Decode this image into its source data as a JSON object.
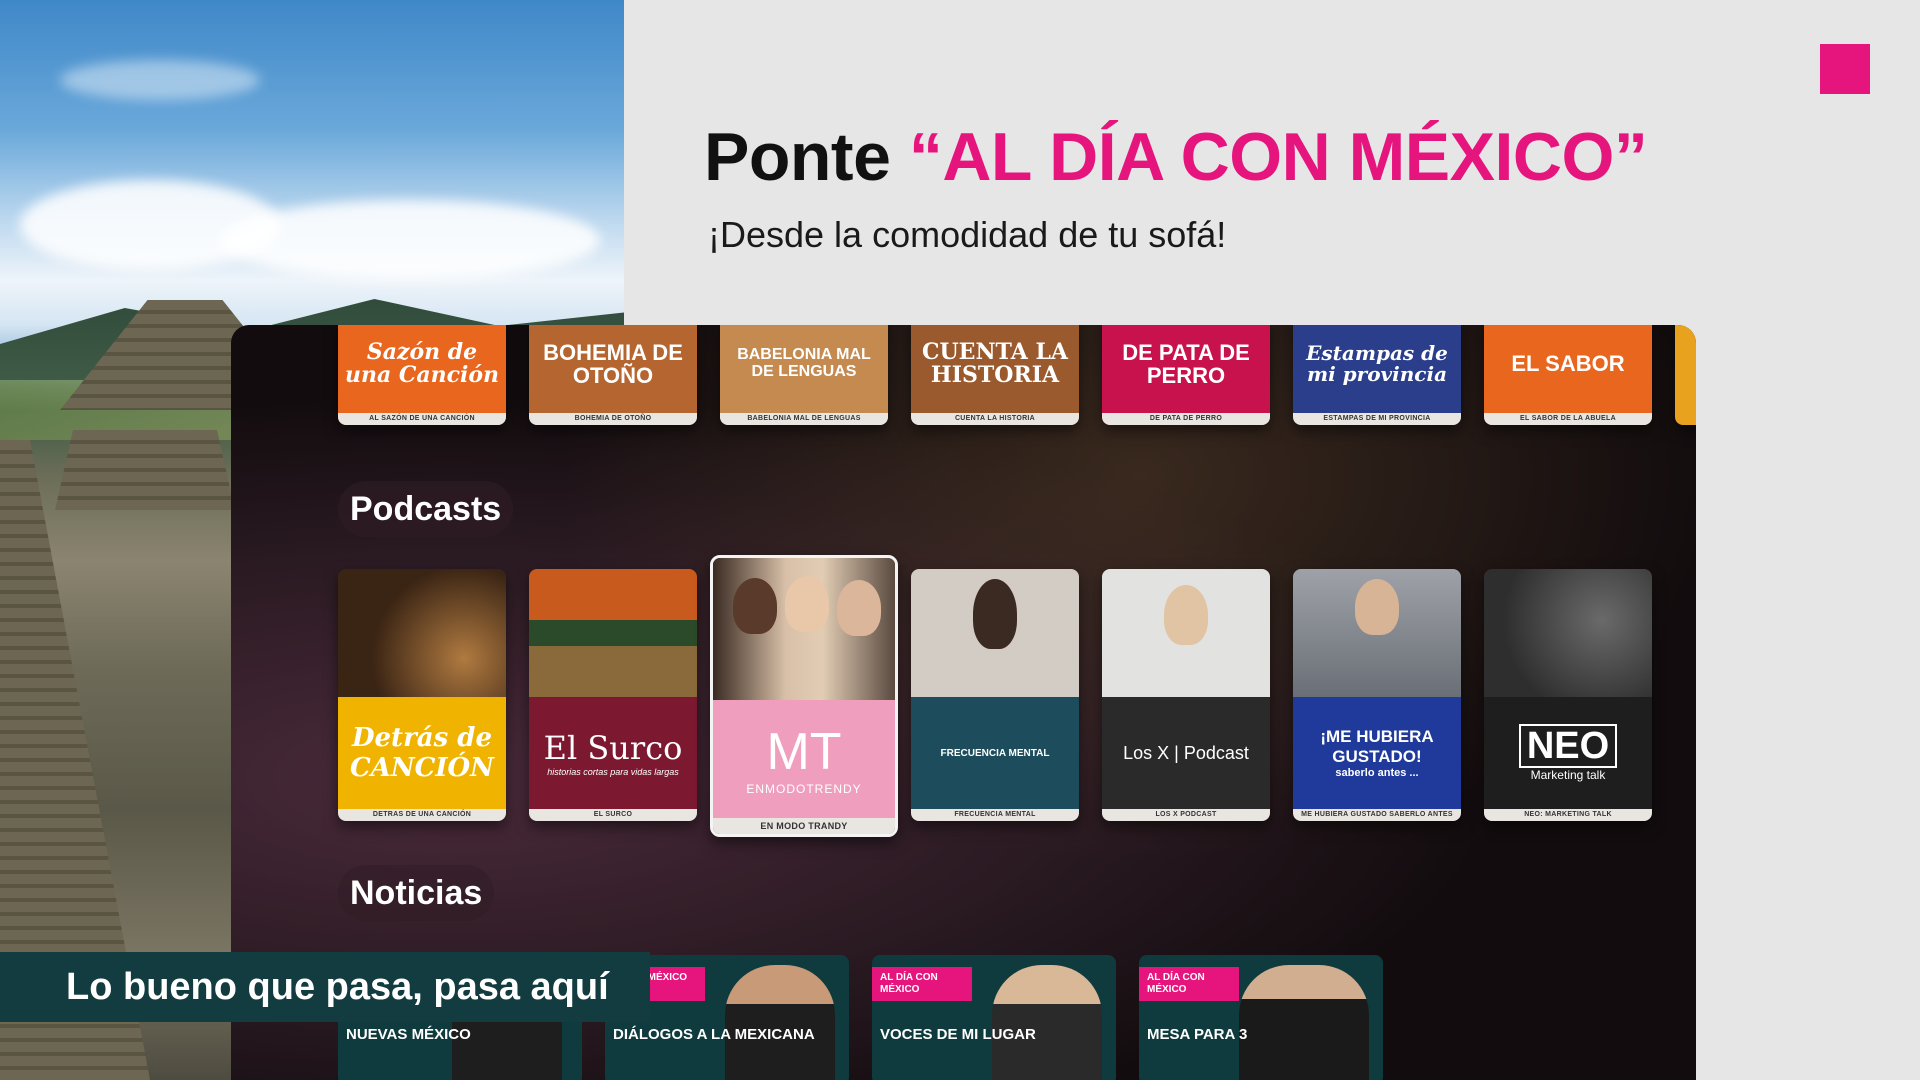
{
  "header": {
    "headline_prefix": "Ponte",
    "headline_accent": "“AL DÍA CON MÉXICO”",
    "subtitle": "¡Desde la comodidad de tu sofá!",
    "accent_color": "#e6157e"
  },
  "tv": {
    "top_row": [
      {
        "art": "Sazón de una Canción",
        "caption": "AL SAZÓN DE UNA CANCIÓN",
        "color": "#e8661e"
      },
      {
        "art": "BOHEMIA DE OTOÑO",
        "caption": "BOHEMIA DE OTOÑO",
        "color": "#b5652f"
      },
      {
        "art": "BABELONIA MAL DE LENGUAS",
        "caption": "BABELONIA MAL DE LENGUAS",
        "color": "#c48a50"
      },
      {
        "art": "CUENTA LA HISTORIA",
        "caption": "CUENTA LA HISTORIA",
        "color": "#9a5a2e"
      },
      {
        "art": "DE PATA DE PERRO",
        "caption": "DE PATA DE PERRO",
        "color": "#c8124e"
      },
      {
        "art": "Estampas de mi provincia",
        "caption": "ESTAMPAS DE MI PROVINCIA",
        "color": "#2b3e8c"
      },
      {
        "art": "EL SABOR",
        "caption": "EL SABOR DE LA ABUELA",
        "color": "#e8661e"
      },
      {
        "art": "",
        "caption": "",
        "color": "#e8a21e"
      }
    ],
    "podcasts_label": "Podcasts",
    "podcasts": [
      {
        "brand": "Detrás de CANCIÓN",
        "caption": "DETRAS DE UNA CANCIÓN",
        "photo_color": "#5a3a22",
        "brand_color": "#f0b400"
      },
      {
        "brand": "El Surco",
        "caption": "EL SURCO",
        "sub": "historias cortas para vidas largas",
        "photo_color": "#8a4a2a",
        "brand_color": "#7c1830"
      },
      {
        "brand": "MT",
        "caption": "EN MODO TRANDY",
        "sub": "ENMODOTRENDY",
        "photo_color": "#6a5a4a",
        "brand_color": "#ef9fbd"
      },
      {
        "brand": "FRECUENCIA MENTAL",
        "caption": "FRECUENCIA MENTAL",
        "photo_color": "#c9c2b8",
        "brand_color": "#1d4d5c"
      },
      {
        "brand": "Los X | Podcast",
        "caption": "LOS X PODCAST",
        "photo_color": "#d8d8d6",
        "brand_color": "#2a2a2a"
      },
      {
        "brand": "¡ME HUBIERA GUSTADO!",
        "caption": "ME HUBIERA GUSTADO SABERLO ANTES",
        "sub": "saberlo antes ...",
        "photo_color": "#8a8e96",
        "brand_color": "#1f3a9a"
      },
      {
        "brand": "NEO",
        "caption": "NEO: MARKETING TALK",
        "sub": "Marketing talk",
        "photo_color": "#4a4a4a",
        "brand_color": "#1e1e1e"
      }
    ],
    "news_label": "Noticias",
    "news": [
      {
        "tag": "",
        "show": "NUEVAS MÉXICO"
      },
      {
        "tag": "A CON MÉXICO",
        "show": "DIÁLOGOS A LA MEXICANA"
      },
      {
        "tag": "AL DÍA CON MÉXICO",
        "show": "VOCES DE MI LUGAR"
      },
      {
        "tag": "AL DÍA CON MÉXICO",
        "show": "MESA PARA 3"
      }
    ]
  },
  "banner": {
    "text": "Lo bueno que pasa, pasa aquí"
  }
}
